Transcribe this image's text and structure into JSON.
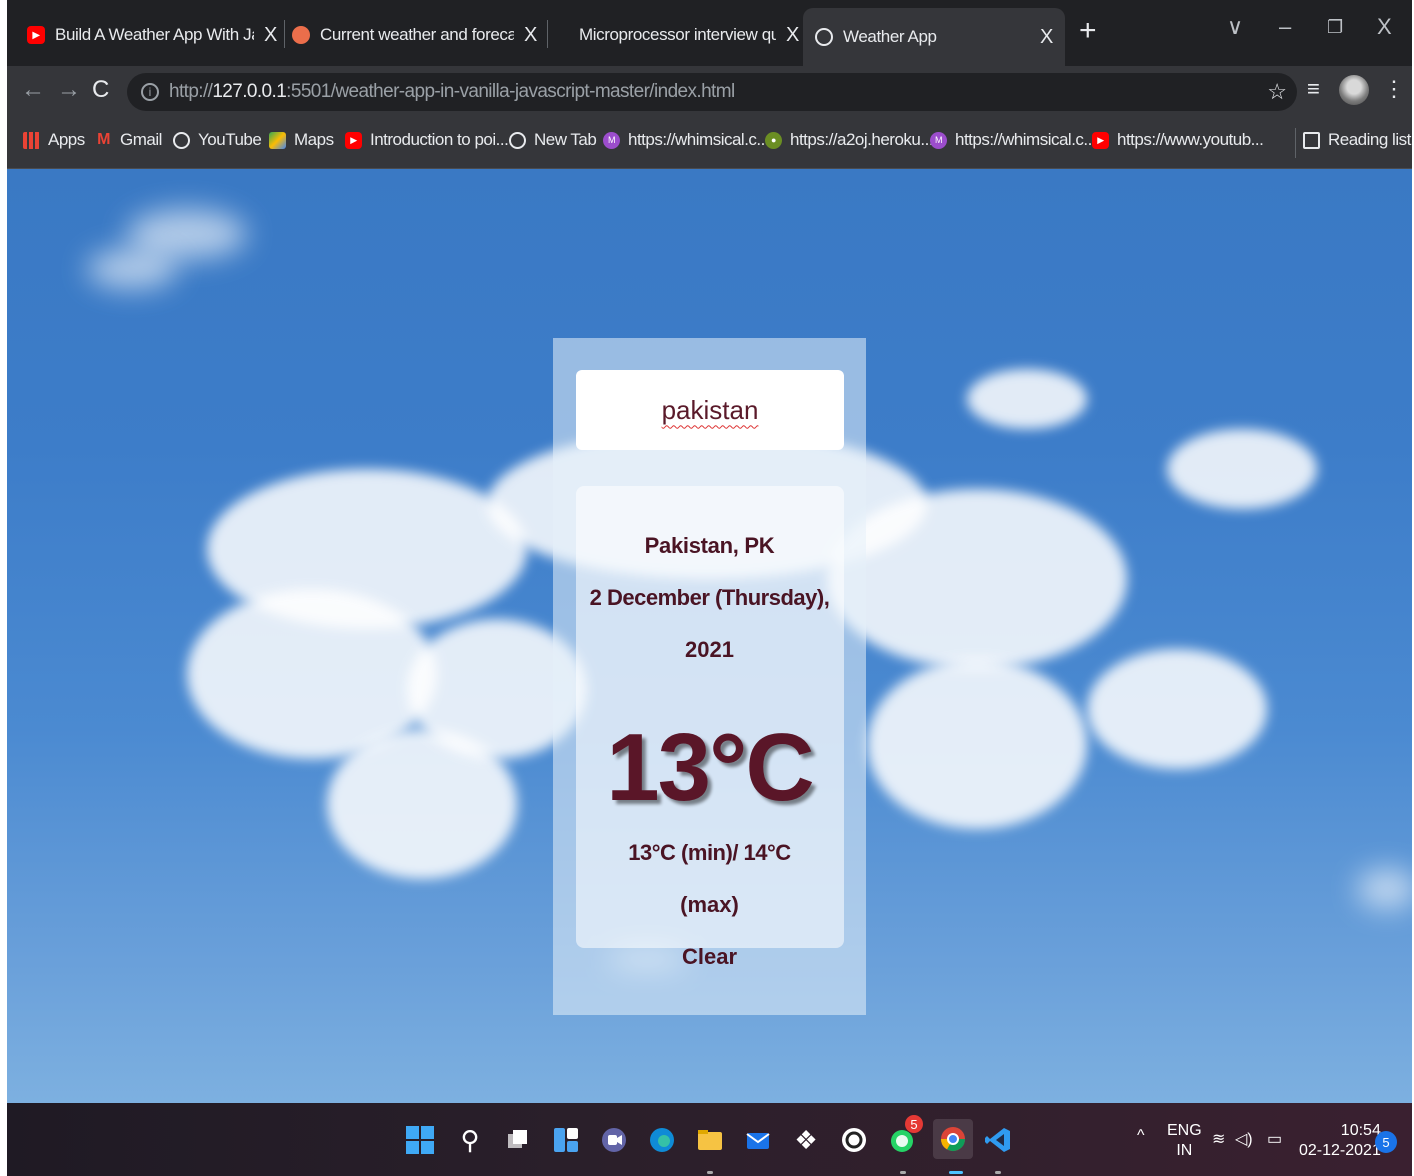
{
  "tabs": [
    {
      "title": "Build A Weather App With Javascr",
      "favicon": "youtube-icon",
      "color": "#ff0000"
    },
    {
      "title": "Current weather and forecast - O",
      "favicon": "openweather-icon",
      "color": "#eb6e4b"
    },
    {
      "title": "Microprocessor interview questio",
      "favicon": "blank-icon",
      "color": "#202124"
    },
    {
      "title": "Weather App",
      "favicon": "globe-icon",
      "color": "#e8eaed"
    }
  ],
  "new_tab": "+",
  "window": {
    "chevron": "∨",
    "minimize": "–",
    "restore": "❐",
    "close": "X"
  },
  "address": {
    "prefix": "http://",
    "host": "127.0.0.1",
    "rest": ":5501/weather-app-in-vanilla-javascript-master/index.html",
    "info": "i"
  },
  "bookmarks": [
    {
      "label": "Apps",
      "icon": "apps-grid-icon"
    },
    {
      "label": "Gmail",
      "icon": "gmail-icon"
    },
    {
      "label": "YouTube",
      "icon": "globe-icon"
    },
    {
      "label": "Maps",
      "icon": "maps-icon"
    },
    {
      "label": "Introduction to poi...",
      "icon": "youtube-icon"
    },
    {
      "label": "New Tab",
      "icon": "globe-icon"
    },
    {
      "label": "https://whimsical.c...",
      "icon": "whimsical-icon"
    },
    {
      "label": "https://a2oj.heroku...",
      "icon": "a2oj-icon"
    },
    {
      "label": "https://whimsical.c...",
      "icon": "whimsical-icon"
    },
    {
      "label": "https://www.youtub...",
      "icon": "youtube-icon"
    }
  ],
  "reading_list": "Reading list",
  "weather": {
    "search_value": "pakistan",
    "city": "Pakistan, PK",
    "date": "2 December (Thursday),",
    "year": "2021",
    "temp": "13°C",
    "minmax": "13°C (min)/ 14°C",
    "max_label": "(max)",
    "condition": "Clear"
  },
  "taskbar": {
    "language": "ENG",
    "region": "IN",
    "time": "10:54",
    "date": "02-12-2021",
    "whatsapp_badge": "5",
    "notification_count": "5"
  },
  "colors": {
    "accent_text": "#4a1424",
    "sky": "#3d7dc9",
    "chrome_dark": "#202124",
    "chrome_mid": "#35363a"
  }
}
